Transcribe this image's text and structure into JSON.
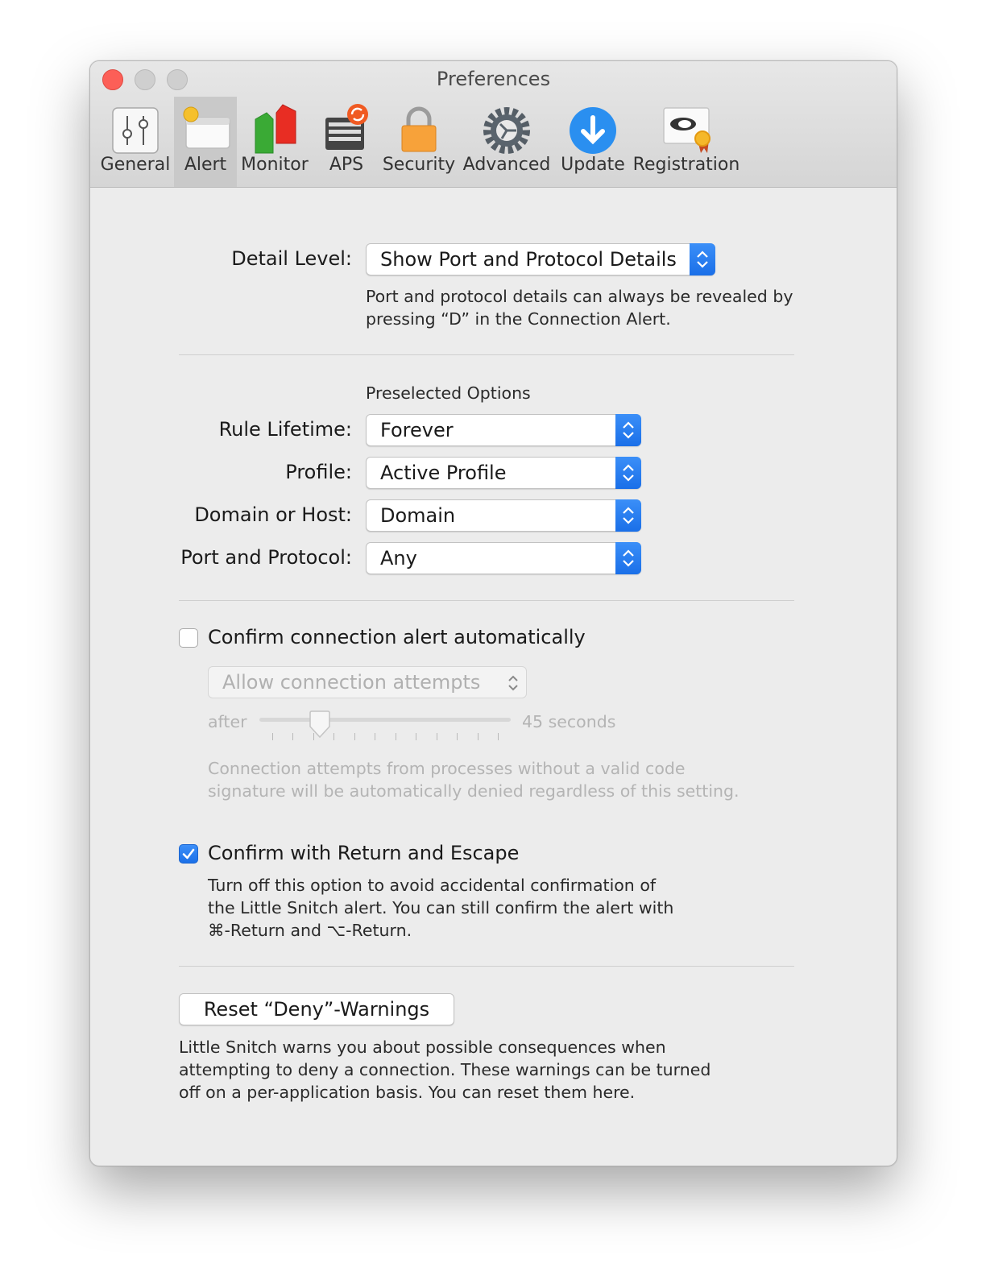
{
  "window": {
    "title": "Preferences"
  },
  "toolbar": {
    "tabs": [
      {
        "label": "General",
        "icon": "sliders-icon",
        "selected": false
      },
      {
        "label": "Alert",
        "icon": "alert-window-icon",
        "selected": true
      },
      {
        "label": "Monitor",
        "icon": "traffic-bars-icon",
        "selected": false
      },
      {
        "label": "APS",
        "icon": "aps-sync-icon",
        "selected": false
      },
      {
        "label": "Security",
        "icon": "padlock-icon",
        "selected": false
      },
      {
        "label": "Advanced",
        "icon": "gear-icon",
        "selected": false
      },
      {
        "label": "Update",
        "icon": "download-arrow-icon",
        "selected": false
      },
      {
        "label": "Registration",
        "icon": "registration-badge-icon",
        "selected": false
      }
    ]
  },
  "detail": {
    "label": "Detail Level:",
    "value": "Show Port and Protocol Details",
    "help_line1": "Port and protocol details can always be revealed by",
    "help_line2": "pressing “D” in the Connection Alert."
  },
  "preselected": {
    "heading": "Preselected Options",
    "rule_lifetime": {
      "label": "Rule Lifetime:",
      "value": "Forever"
    },
    "profile": {
      "label": "Profile:",
      "value": "Active Profile"
    },
    "domain_host": {
      "label": "Domain or Host:",
      "value": "Domain"
    },
    "port_protocol": {
      "label": "Port and Protocol:",
      "value": "Any"
    }
  },
  "auto_confirm": {
    "label": "Confirm connection alert automatically",
    "checked": false,
    "action_value": "Allow connection attempts",
    "after_label": "after",
    "seconds_label": "45 seconds",
    "slider_fraction": 0.21,
    "tick_count": 12,
    "help_line1": "Connection attempts from processes without a valid code",
    "help_line2": "signature will be automatically denied regardless of this setting."
  },
  "return_escape": {
    "label": "Confirm with Return and Escape",
    "checked": true,
    "help_line1": "Turn off this option to avoid accidental confirmation of",
    "help_line2": "the Little Snitch alert. You can still confirm the alert with",
    "help_line3": "⌘-Return and ⌥-Return."
  },
  "reset": {
    "button_label": "Reset “Deny”-Warnings",
    "help_line1": "Little Snitch warns you about possible consequences when",
    "help_line2": "attempting to deny a connection. These warnings can be turned",
    "help_line3": "off on a per-application basis. You can reset them here."
  },
  "colors": {
    "accent": "#1f74ec",
    "close": "#fc5f57",
    "window_bg": "#ececec"
  }
}
